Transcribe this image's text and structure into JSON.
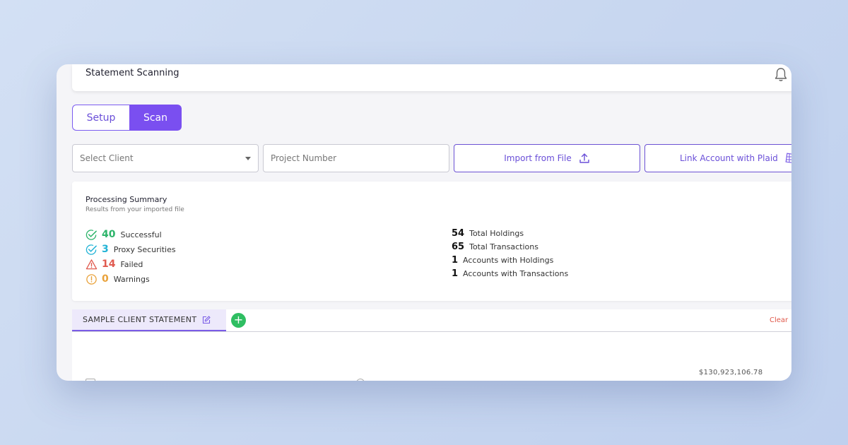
{
  "header": {
    "title": "Statement Scanning",
    "bell_icon": "bell-icon"
  },
  "mode_toggle": {
    "setup_label": "Setup",
    "scan_label": "Scan",
    "active": "Scan"
  },
  "filters": {
    "client_select_value": "Select Client",
    "project_placeholder": "Project Number",
    "import_label": "Import from File",
    "plaid_label": "Link Account with Plaid"
  },
  "summary": {
    "title": "Processing Summary",
    "subtitle": "Results from your imported file",
    "left": [
      {
        "value": "40",
        "label": "Successful",
        "color": "#2db46a",
        "icon": "check-circle-icon"
      },
      {
        "value": "3",
        "label": "Proxy Securities",
        "color": "#22b3d6",
        "icon": "check-circle-icon"
      },
      {
        "value": "14",
        "label": "Failed",
        "color": "#e05a4f",
        "icon": "warning-triangle-icon"
      },
      {
        "value": "0",
        "label": "Warnings",
        "color": "#e9a23b",
        "icon": "info-circle-icon"
      }
    ],
    "right": [
      {
        "value": "54",
        "label": "Total Holdings"
      },
      {
        "value": "65",
        "label": "Total Transactions"
      },
      {
        "value": "1",
        "label": "Accounts with Holdings"
      },
      {
        "value": "1",
        "label": "Accounts with Transactions"
      }
    ]
  },
  "tabs": {
    "items": [
      {
        "label": "SAMPLE CLIENT STATEMENT"
      }
    ],
    "add_label": "+",
    "clear_label": "Clear"
  },
  "content": {
    "amount": "$130,923,106.78"
  },
  "colors": {
    "accent": "#7a4ff0",
    "success": "#2fbe62",
    "danger": "#e0584a"
  }
}
